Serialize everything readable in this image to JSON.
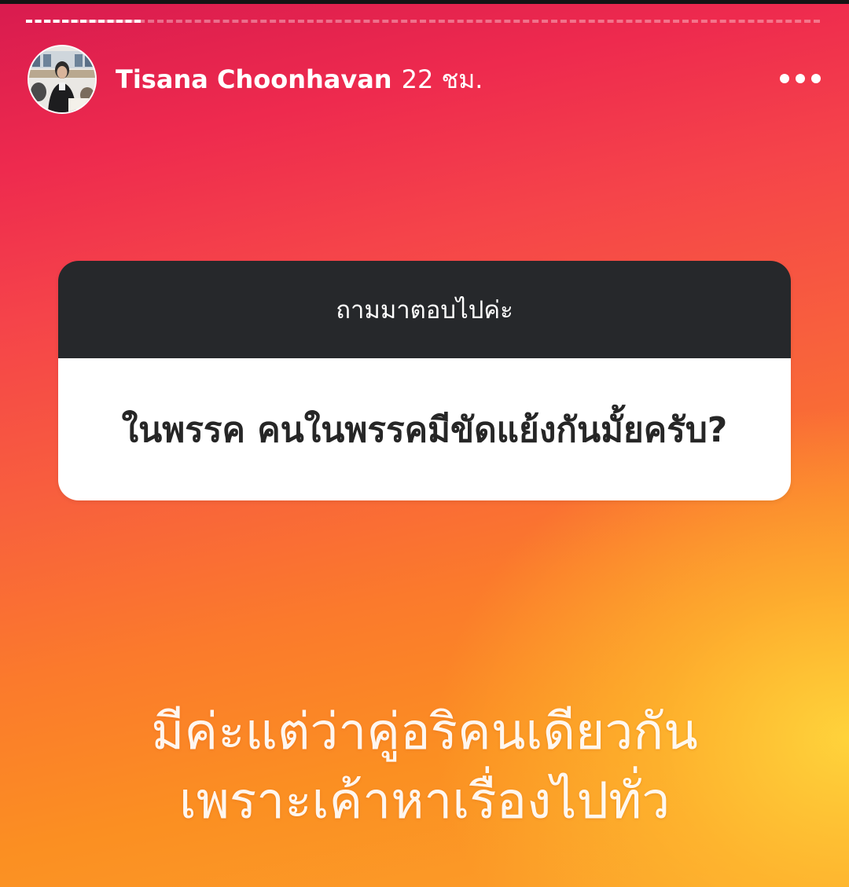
{
  "story": {
    "progress_fraction": 0.145,
    "author": {
      "name": "Tisana Choonhavan",
      "time_ago": "22 ชม."
    },
    "more_icon": "more-horizontal-icon",
    "question_sticker": {
      "prompt": "ถามมาตอบไปค่ะ",
      "question": "ในพรรค คนในพรรคมีขัดแย้งกันมั้ยครับ?"
    },
    "answer": {
      "lines": [
        "มีค่ะแต่ว่าคู่อริคนเดียวกัน",
        "เพราะเค้าหาเรื่องไปทั่ว"
      ]
    }
  },
  "colors": {
    "gradient_top": "#d81b4f",
    "gradient_mid": "#f8603d",
    "gradient_bottom_right": "#ffd63c",
    "sticker_header": "#26282b",
    "sticker_body": "#ffffff"
  }
}
